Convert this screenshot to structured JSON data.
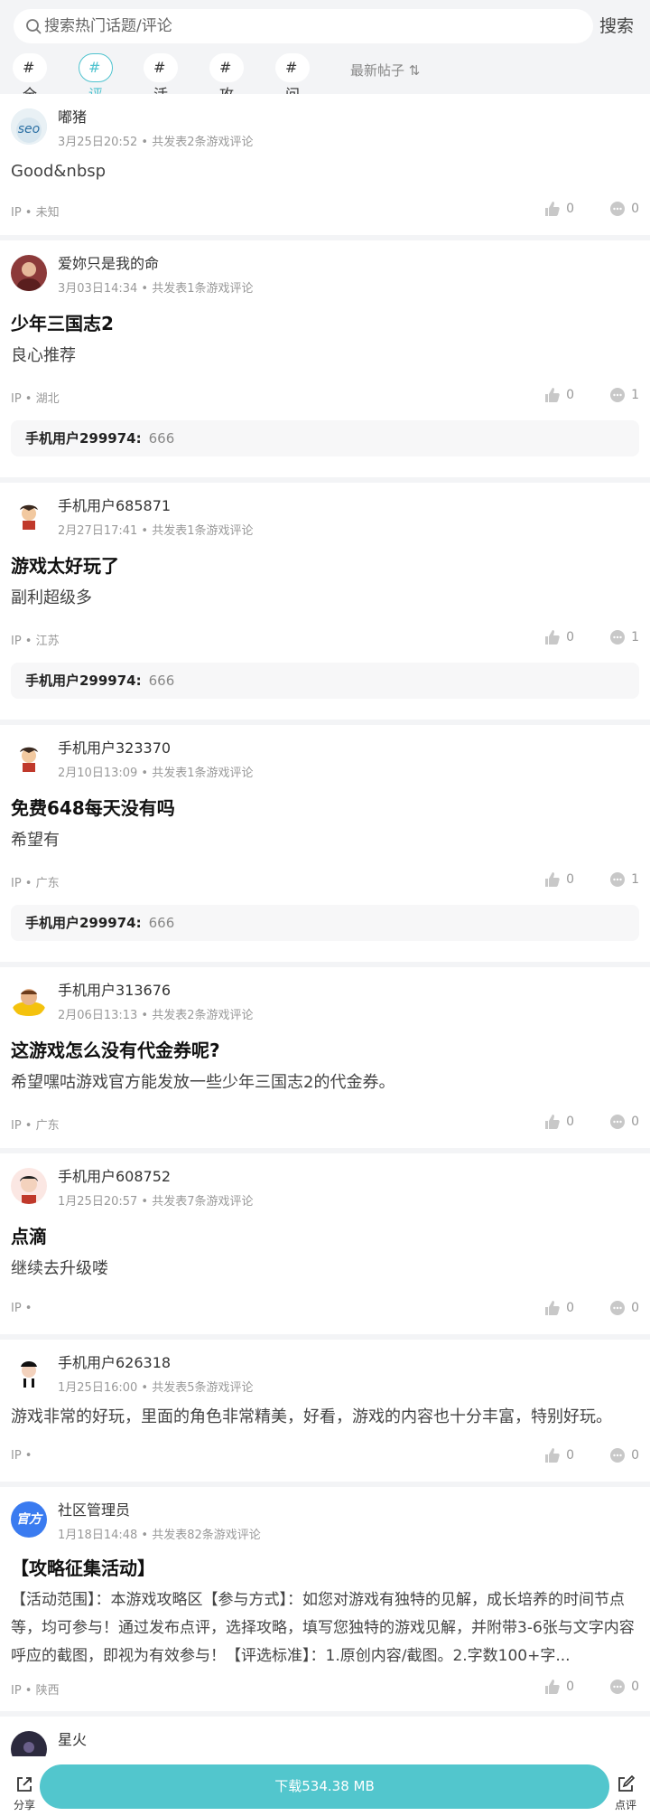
{
  "search": {
    "placeholder": "搜索热门话题/评论",
    "button": "搜索"
  },
  "tags": [
    "#全部",
    "#评论",
    "#活动",
    "#攻略",
    "#问答"
  ],
  "sort_label": "最新帖子",
  "posts": [
    {
      "user": "嘟猪",
      "meta": "3月25日20:52 • 共发表2条游戏评论",
      "title": "",
      "body": "Good&nbsp",
      "ip": "IP • 未知",
      "likes": "0",
      "comments": "0",
      "reply": null
    },
    {
      "user": "爱妳只是我的命",
      "meta": "3月03日14:34 • 共发表1条游戏评论",
      "title": "少年三国志2",
      "body": "良心推荐",
      "ip": "IP • 湖北",
      "likes": "0",
      "comments": "1",
      "reply": {
        "user": "手机用户299974:",
        "text": "666"
      }
    },
    {
      "user": "手机用户685871",
      "meta": "2月27日17:41 • 共发表1条游戏评论",
      "title": "游戏太好玩了",
      "body": "副利超级多",
      "ip": "IP • 江苏",
      "likes": "0",
      "comments": "1",
      "reply": {
        "user": "手机用户299974:",
        "text": "666"
      }
    },
    {
      "user": "手机用户323370",
      "meta": "2月10日13:09 • 共发表1条游戏评论",
      "title": "免费648每天没有吗",
      "body": "希望有",
      "ip": "IP • 广东",
      "likes": "0",
      "comments": "1",
      "reply": {
        "user": "手机用户299974:",
        "text": "666"
      }
    },
    {
      "user": "手机用户313676",
      "meta": "2月06日13:13 • 共发表2条游戏评论",
      "title": "这游戏怎么没有代金券呢?",
      "body": "希望嘿咕游戏官方能发放一些少年三国志2的代金券。",
      "ip": "IP • 广东",
      "likes": "0",
      "comments": "0",
      "reply": null
    },
    {
      "user": "手机用户608752",
      "meta": "1月25日20:57 • 共发表7条游戏评论",
      "title": "点滴",
      "body": "继续去升级喽",
      "ip": "IP •",
      "likes": "0",
      "comments": "0",
      "reply": null
    },
    {
      "user": "手机用户626318",
      "meta": "1月25日16:00 • 共发表5条游戏评论",
      "title": "",
      "body": "游戏非常的好玩，里面的角色非常精美，好看，游戏的内容也十分丰富，特别好玩。",
      "ip": "IP •",
      "likes": "0",
      "comments": "0",
      "reply": null
    },
    {
      "user": "社区管理员",
      "meta": "1月18日14:48 • 共发表82条游戏评论",
      "title": "【攻略征集活动】",
      "body": "【活动范围】：本游戏攻略区【参与方式】：如您对游戏有独特的见解，成长培养的时间节点等，均可参与！通过发布点评，选择攻略，填写您独特的游戏见解，并附带3-6张与文字内容呼应的截图，即视为有效参与！【评选标准】：1.原创内容/截图。2.字数100+字...",
      "ip": "IP • 陕西",
      "likes": "0",
      "comments": "0",
      "reply": null,
      "avatar_text": "官方"
    },
    {
      "user": "星火",
      "meta": "",
      "title": "",
      "body": "",
      "ip": "",
      "likes": "",
      "comments": "",
      "reply": null
    }
  ],
  "bottom": {
    "share": "分享",
    "download": "下载534.38 MB",
    "review": "点评"
  },
  "colors": {
    "accent": "#4fc3cf",
    "download_bg": "#52c6cd",
    "official_avatar": "#3a7bf0"
  }
}
